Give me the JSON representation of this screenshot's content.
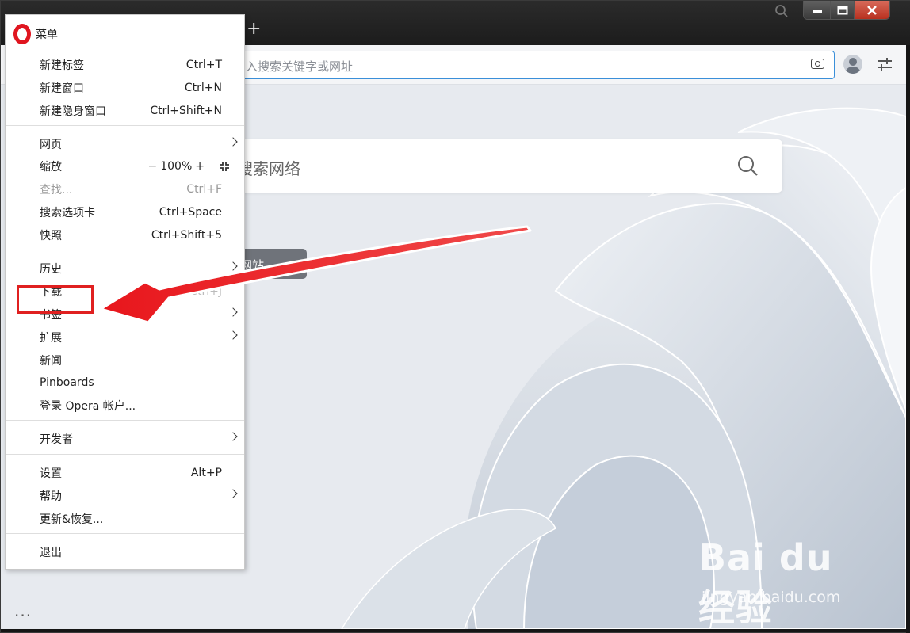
{
  "titlebar": {
    "new_tab_label": "+",
    "minimize_label": "—",
    "maximize_label": "□",
    "close_label": "✕"
  },
  "toolbar": {
    "address_placeholder": "入搜索关键字或网址"
  },
  "content": {
    "search_placeholder": "搜索网络",
    "speed_dial_label": "网站"
  },
  "menu": {
    "title": "菜单",
    "items": [
      {
        "label": "新建标签",
        "shortcut": "Ctrl+T"
      },
      {
        "label": "新建窗口",
        "shortcut": "Ctrl+N"
      },
      {
        "label": "新建隐身窗口",
        "shortcut": "Ctrl+Shift+N"
      },
      {
        "label": "网页",
        "shortcut": ""
      },
      {
        "label": "缩放",
        "shortcut": ""
      },
      {
        "label": "查找...",
        "shortcut": "Ctrl+F"
      },
      {
        "label": "搜索选项卡",
        "shortcut": "Ctrl+Space"
      },
      {
        "label": "快照",
        "shortcut": "Ctrl+Shift+5"
      },
      {
        "label": "历史",
        "shortcut": ""
      },
      {
        "label": "下载",
        "shortcut": "Ctrl+J"
      },
      {
        "label": "书签",
        "shortcut": ""
      },
      {
        "label": "扩展",
        "shortcut": ""
      },
      {
        "label": "新闻",
        "shortcut": ""
      },
      {
        "label": "Pinboards",
        "shortcut": ""
      },
      {
        "label": "登录 Opera 帐户...",
        "shortcut": ""
      },
      {
        "label": "开发者",
        "shortcut": ""
      },
      {
        "label": "设置",
        "shortcut": "Alt+P"
      },
      {
        "label": "帮助",
        "shortcut": ""
      },
      {
        "label": "更新&恢复...",
        "shortcut": ""
      },
      {
        "label": "退出",
        "shortcut": ""
      }
    ],
    "zoom": {
      "minus": "−",
      "value": "100%",
      "plus": "+"
    }
  },
  "sidebar": {
    "more_label": "..."
  },
  "watermark": {
    "logo_text": "Bai du 经验",
    "url": "jingyan.baidu.com"
  },
  "colors": {
    "accent": "#3a8fd9",
    "opera_red": "#e0151f",
    "annotation_red": "#e02020"
  }
}
